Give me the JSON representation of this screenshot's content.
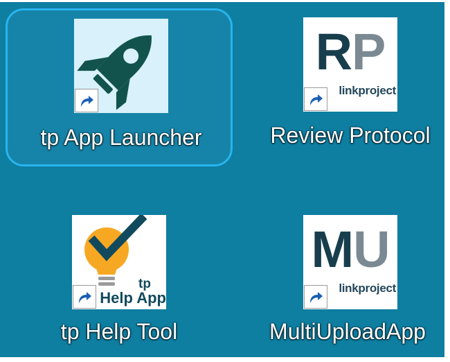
{
  "desktop": {
    "accent_color": "#27b4ee",
    "background_color": "#0e7ea1",
    "shortcuts": [
      {
        "label": "tp App Launcher",
        "icon": "rocket-icon",
        "selected": true,
        "tile_color": "#d8f1fa",
        "icon_color": "#12544d"
      },
      {
        "label": "Review Protocol",
        "icon": "review-protocol-logo",
        "selected": false,
        "letters": [
          "R",
          "P"
        ],
        "brand": "linkproject"
      },
      {
        "label": "tp Help Tool",
        "icon": "lightbulb-check-icon",
        "selected": false,
        "tile_text_tp": "tp",
        "tile_text_help": "Help App",
        "bulb_color": "#f7a823",
        "check_color": "#124a5d"
      },
      {
        "label": "MultiUploadApp",
        "icon": "multi-upload-logo",
        "selected": false,
        "letters": [
          "M",
          "U"
        ],
        "brand": "linkproject"
      }
    ]
  }
}
